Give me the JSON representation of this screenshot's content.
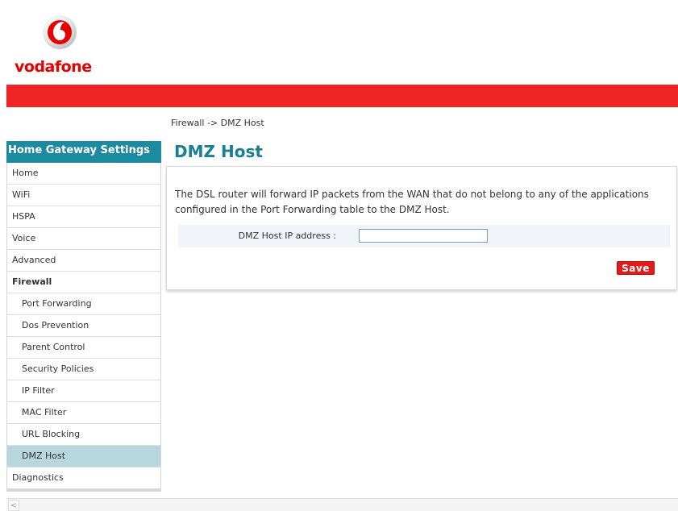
{
  "brand": {
    "name": "vodafone",
    "color": "#e60000"
  },
  "breadcrumb": "Firewall -> DMZ Host",
  "sidebar": {
    "header": "Home Gateway Settings",
    "items": [
      {
        "label": "Home",
        "type": "top"
      },
      {
        "label": "WiFi",
        "type": "top"
      },
      {
        "label": "HSPA",
        "type": "top"
      },
      {
        "label": "Voice",
        "type": "top"
      },
      {
        "label": "Advanced",
        "type": "top"
      },
      {
        "label": "Firewall",
        "type": "group"
      },
      {
        "label": "Port Forwarding",
        "type": "sub"
      },
      {
        "label": "Dos Prevention",
        "type": "sub"
      },
      {
        "label": "Parent Control",
        "type": "sub"
      },
      {
        "label": "Security Policies",
        "type": "sub"
      },
      {
        "label": "IP Filter",
        "type": "sub"
      },
      {
        "label": "MAC Filter",
        "type": "sub"
      },
      {
        "label": "URL Blocking",
        "type": "sub"
      },
      {
        "label": "DMZ Host",
        "type": "sub",
        "selected": true
      },
      {
        "label": "Diagnostics",
        "type": "top"
      }
    ]
  },
  "main": {
    "title": "DMZ Host",
    "description": "The DSL router will forward IP packets from the WAN that do not belong to any of the applications configured in the Port Forwarding table to the DMZ Host.",
    "ip_label": "DMZ Host IP address :",
    "ip_value": "",
    "save_label": "Save"
  },
  "scrollbar": {
    "left_arrow": "<"
  },
  "colors": {
    "accent_red": "#ee2524",
    "accent_teal": "#1c8ba0",
    "selected_bg": "#b7d6dd"
  }
}
